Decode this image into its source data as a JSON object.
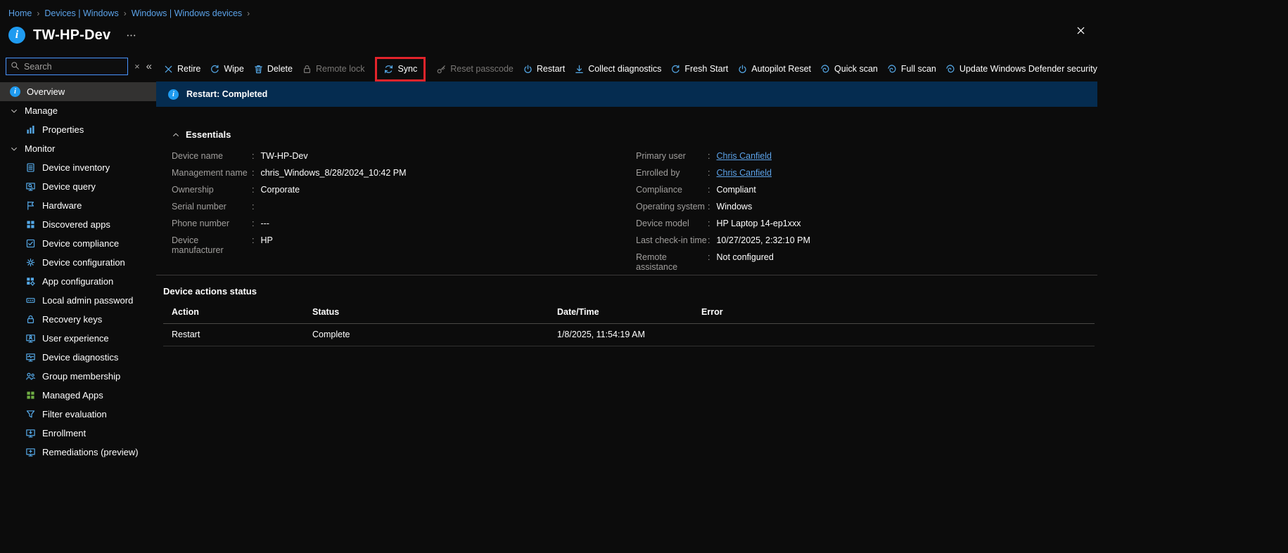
{
  "colors": {
    "accent_blue": "#55a9e8",
    "link_blue": "#5ba2e8",
    "highlight_red": "#e3242b",
    "banner_bg": "#052c50",
    "green": "#6fae44"
  },
  "breadcrumb": {
    "separator": "›",
    "items": [
      "Home",
      "Devices | Windows",
      "Windows | Windows devices"
    ]
  },
  "header": {
    "title": "TW-HP-Dev"
  },
  "sidebar": {
    "search": {
      "placeholder": "Search",
      "clear_glyph": "×",
      "collapse_glyph": "«"
    },
    "items": [
      {
        "label": "Overview",
        "icon": "info",
        "selected": true
      },
      {
        "label": "Manage",
        "group": true
      },
      {
        "label": "Properties",
        "icon": "columns",
        "indent": true
      },
      {
        "label": "Monitor",
        "group": true
      },
      {
        "label": "Device inventory",
        "icon": "clipboard",
        "indent": true
      },
      {
        "label": "Device query",
        "icon": "monitor-search",
        "indent": true
      },
      {
        "label": "Hardware",
        "icon": "flag",
        "indent": true
      },
      {
        "label": "Discovered apps",
        "icon": "grid",
        "indent": true
      },
      {
        "label": "Device compliance",
        "icon": "checklist",
        "indent": true
      },
      {
        "label": "Device configuration",
        "icon": "gear",
        "indent": true
      },
      {
        "label": "App configuration",
        "icon": "grid-gear",
        "indent": true
      },
      {
        "label": "Local admin password",
        "icon": "password",
        "indent": true
      },
      {
        "label": "Recovery keys",
        "icon": "lock",
        "indent": true
      },
      {
        "label": "User experience",
        "icon": "monitor-user",
        "indent": true
      },
      {
        "label": "Device diagnostics",
        "icon": "monitor-pulse",
        "indent": true
      },
      {
        "label": "Group membership",
        "icon": "people",
        "indent": true
      },
      {
        "label": "Managed Apps",
        "icon": "grid",
        "indent": true,
        "icon_color": "#6fae44"
      },
      {
        "label": "Filter evaluation",
        "icon": "funnel",
        "indent": true
      },
      {
        "label": "Enrollment",
        "icon": "monitor-arrow",
        "indent": true
      },
      {
        "label": "Remediations (preview)",
        "icon": "monitor-plus",
        "indent": true
      }
    ]
  },
  "toolbar": {
    "items": [
      {
        "label": "Retire",
        "icon": "close-x"
      },
      {
        "label": "Wipe",
        "icon": "undo"
      },
      {
        "label": "Delete",
        "icon": "trash"
      },
      {
        "label": "Remote lock",
        "icon": "lock",
        "disabled": true
      },
      {
        "label": "Sync",
        "icon": "sync",
        "highlighted": true
      },
      {
        "label": "Reset passcode",
        "icon": "key",
        "disabled": true
      },
      {
        "label": "Restart",
        "icon": "power"
      },
      {
        "label": "Collect diagnostics",
        "icon": "download"
      },
      {
        "label": "Fresh Start",
        "icon": "undo"
      },
      {
        "label": "Autopilot Reset",
        "icon": "power"
      },
      {
        "label": "Quick scan",
        "icon": "defender-scan"
      },
      {
        "label": "Full scan",
        "icon": "defender-scan"
      },
      {
        "label": "Update Windows Defender security intelligence",
        "icon": "defender-scan"
      }
    ]
  },
  "banner": {
    "text": "Restart: Completed"
  },
  "essentials": {
    "title": "Essentials",
    "left": [
      {
        "label": "Device name",
        "value": "TW-HP-Dev"
      },
      {
        "label": "Management name",
        "value": "chris_Windows_8/28/2024_10:42 PM"
      },
      {
        "label": "Ownership",
        "value": "Corporate"
      },
      {
        "label": "Serial number",
        "value": ""
      },
      {
        "label": "Phone number",
        "value": "---"
      },
      {
        "label": "Device manufacturer",
        "value": "HP"
      }
    ],
    "right": [
      {
        "label": "Primary user",
        "value": "Chris Canfield",
        "link": true
      },
      {
        "label": "Enrolled by",
        "value": "Chris Canfield",
        "link": true
      },
      {
        "label": "Compliance",
        "value": "Compliant"
      },
      {
        "label": "Operating system",
        "value": "Windows"
      },
      {
        "label": "Device model",
        "value": "HP Laptop 14-ep1xxx"
      },
      {
        "label": "Last check-in time",
        "value": "10/27/2025, 2:32:10 PM"
      },
      {
        "label": "Remote assistance",
        "value": "Not configured"
      }
    ]
  },
  "actions_table": {
    "title": "Device actions status",
    "columns": [
      "Action",
      "Status",
      "Date/Time",
      "Error"
    ],
    "rows": [
      [
        "Restart",
        "Complete",
        "1/8/2025, 11:54:19 AM",
        ""
      ]
    ]
  }
}
